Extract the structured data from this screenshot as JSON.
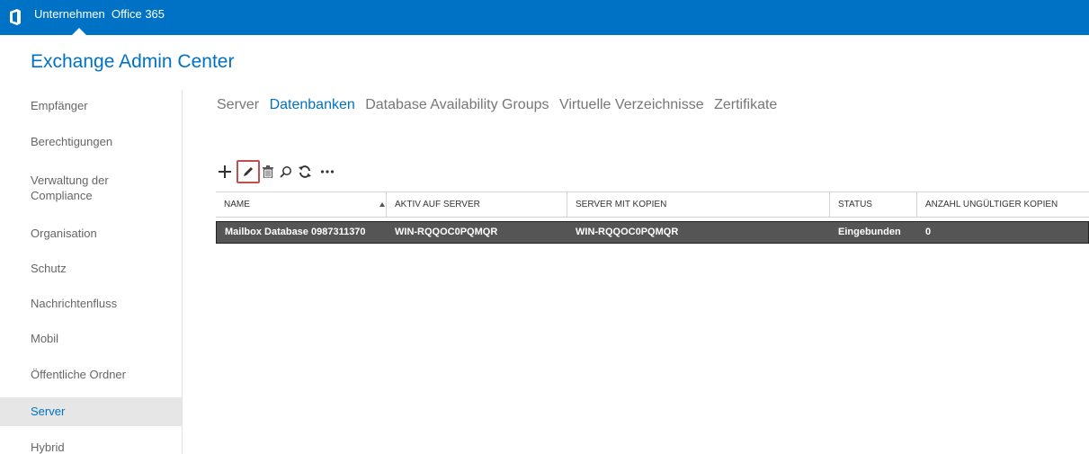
{
  "topbar": {
    "company_label": "Unternehmen",
    "office_label": "Office 365",
    "bg_color": "#0072c6"
  },
  "app_title": "Exchange Admin Center",
  "sidebar": {
    "items": [
      {
        "label": "Empfänger"
      },
      {
        "label": "Berechtigungen"
      },
      {
        "label": "Verwaltung der"
      },
      {
        "label": "Compliance"
      },
      {
        "label": "Organisation"
      },
      {
        "label": "Schutz"
      },
      {
        "label": "Nachrichtenfluss"
      },
      {
        "label": "Mobil"
      },
      {
        "label": "Öffentliche Ordner"
      },
      {
        "label": "Server",
        "selected": true
      },
      {
        "label": "Hybrid"
      }
    ]
  },
  "tabs": [
    {
      "label": "Server"
    },
    {
      "label": "Datenbanken",
      "active": true
    },
    {
      "label": "Database Availability Groups"
    },
    {
      "label": "Virtuelle Verzeichnisse"
    },
    {
      "label": "Zertifikate"
    }
  ],
  "toolbar": {
    "icons": [
      "plus-icon",
      "pencil-icon",
      "trash-icon",
      "search-icon",
      "refresh-icon",
      "more-icon"
    ],
    "more_label": "..."
  },
  "grid": {
    "columns": [
      {
        "label": "NAME"
      },
      {
        "label": "AKTIV AUF SERVER"
      },
      {
        "label": "SERVER MIT KOPIEN"
      },
      {
        "label": "STATUS"
      },
      {
        "label": "ANZAHL UNGÜLTIGER KOPIEN"
      }
    ],
    "rows": [
      {
        "name": "Mailbox Database 0987311370",
        "active_server": "WIN-RQQOC0PQMQR",
        "copy_server": "WIN-RQQOC0PQMQR",
        "status": "Eingebunden",
        "bad_copies": "0",
        "selected": true
      }
    ]
  },
  "colors": {
    "accent": "#0072c6",
    "selected_row": "#555555",
    "edit_highlight": "#c0504d"
  }
}
